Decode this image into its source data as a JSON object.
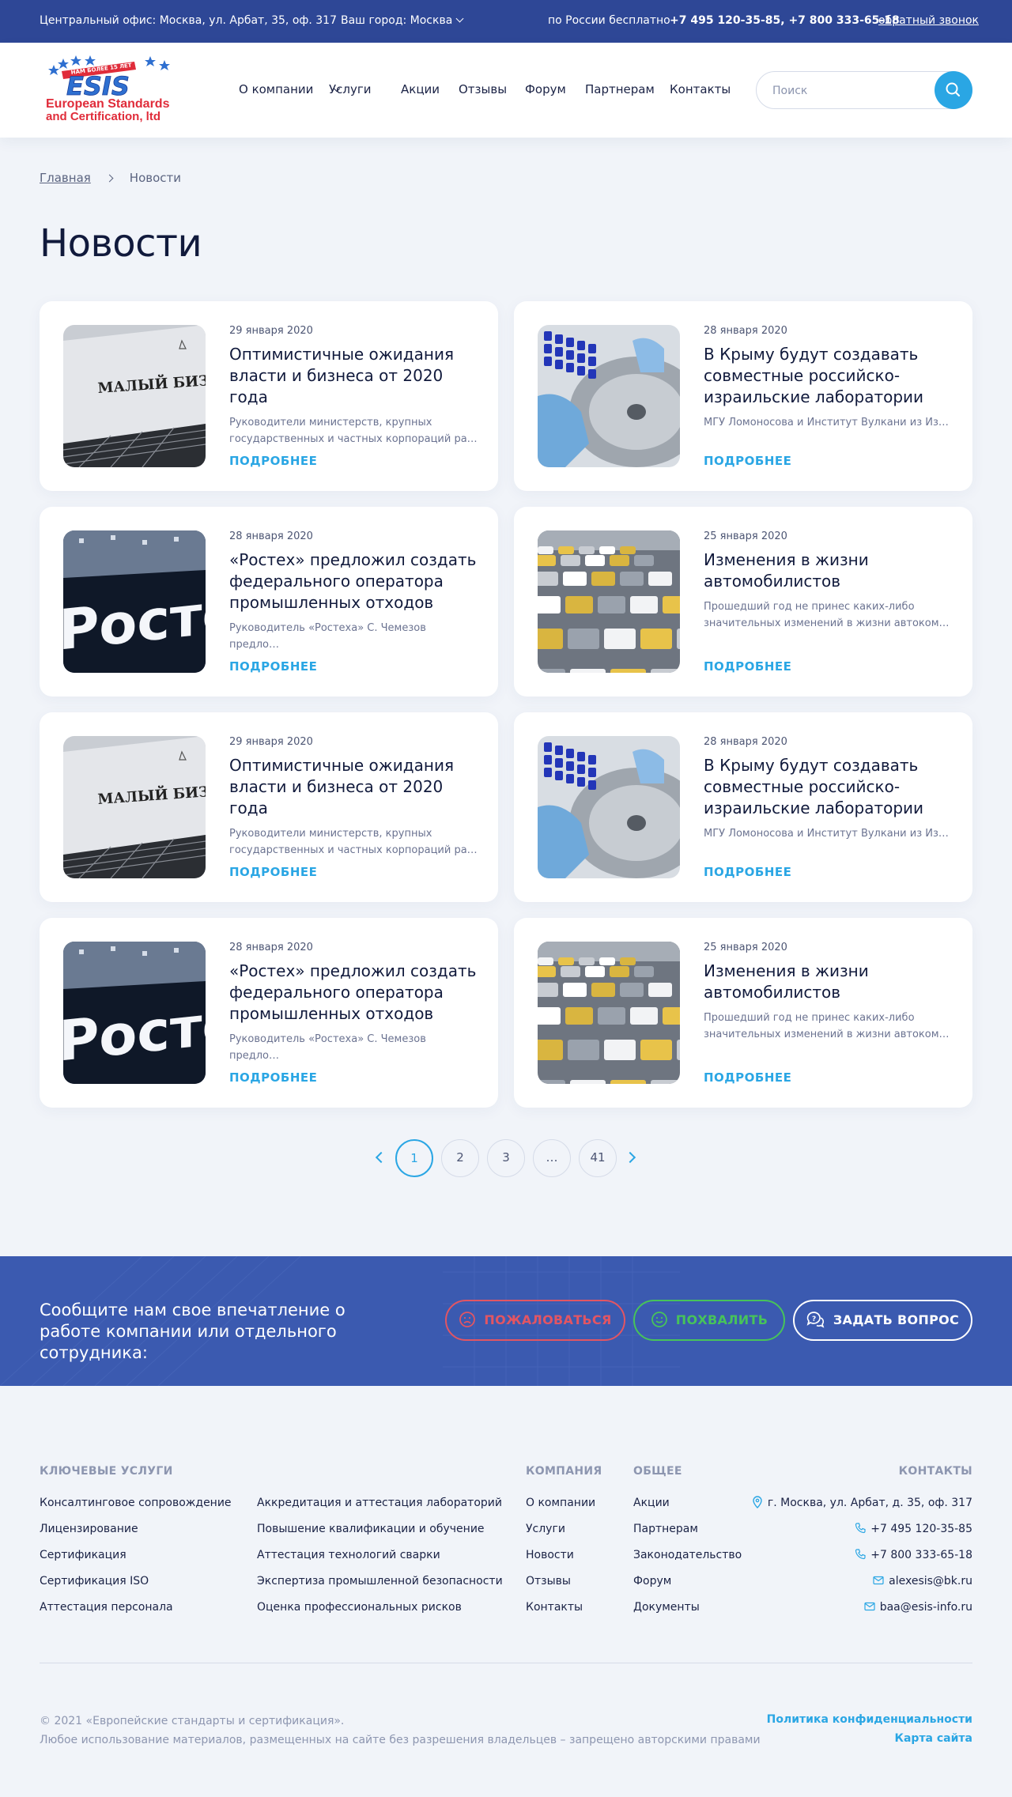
{
  "topbar": {
    "office": "Центральный офис: Москва, ул. Арбат, 35, оф. 317",
    "city": "Ваш город: Москва",
    "free_label": "по России бесплатно",
    "phones": "+7 495 120-35-85, +7 800 333-65-18",
    "callback": "обратный звонок"
  },
  "logo": {
    "badge": "НАМ БОЛЕЕ 15 ЛЕТ",
    "brand": "ESIS",
    "line1": "European Standards",
    "line2": "and Certification, ltd"
  },
  "nav": {
    "about": "О компании",
    "services": "Услуги",
    "promo": "Акции",
    "reviews": "Отзывы",
    "forum": "Форум",
    "partners": "Партнерам",
    "contacts": "Контакты"
  },
  "search": {
    "placeholder": "Поиск"
  },
  "breadcrumb": {
    "home": "Главная",
    "current": "Новости"
  },
  "page_title": "Новости",
  "news": [
    {
      "date": "29 января 2020",
      "title": "Оптимистичные ожидания власти и бизнеса от 2020 года",
      "desc": "Руководители министерств, крупных государственных и частных корпораций ра…",
      "more": "ПОДРОБНЕЕ",
      "image": "business-sign",
      "image_text": "МАЛЫЙ БИЗНЕС"
    },
    {
      "date": "28 января 2020",
      "title": "В Крыму будут создавать совместные российско-израильские лаборатории",
      "desc": "МГУ Ломоносова и Институт Вулкани из Из…",
      "more": "ПОДРОБНЕЕ",
      "image": "lab-centrifuge"
    },
    {
      "date": "28 января 2020",
      "title": "«Ростех» предложил создать федерального оператора промышленных отходов",
      "desc": "Руководитель «Ростеха» С. Чемезов предло…",
      "more": "ПОДРОБНЕЕ",
      "image": "rostec-sign",
      "image_text": "Ростех"
    },
    {
      "date": "25 января 2020",
      "title": "Изменения в жизни автомобилистов",
      "desc": "Прошедший год не принес каких-либо значительных изменений в жизни автоком…",
      "more": "ПОДРОБНЕЕ",
      "image": "traffic-jam"
    },
    {
      "date": "29 января 2020",
      "title": "Оптимистичные ожидания власти и бизнеса от 2020 года",
      "desc": "Руководители министерств, крупных государственных и частных корпораций ра…",
      "more": "ПОДРОБНЕЕ",
      "image": "business-sign",
      "image_text": "МАЛЫЙ БИЗНЕС"
    },
    {
      "date": "28 января 2020",
      "title": "В Крыму будут создавать совместные российско-израильские лаборатории",
      "desc": "МГУ Ломоносова и Институт Вулкани из Из…",
      "more": "ПОДРОБНЕЕ",
      "image": "lab-centrifuge"
    },
    {
      "date": "28 января 2020",
      "title": "«Ростех» предложил создать федерального оператора промышленных отходов",
      "desc": "Руководитель «Ростеха» С. Чемезов предло…",
      "more": "ПОДРОБНЕЕ",
      "image": "rostec-sign",
      "image_text": "Ростех"
    },
    {
      "date": "25 января 2020",
      "title": "Изменения в жизни автомобилистов",
      "desc": "Прошедший год не принес каких-либо значительных изменений в жизни автоком…",
      "more": "ПОДРОБНЕЕ",
      "image": "traffic-jam"
    }
  ],
  "pagination": {
    "pages": [
      "1",
      "2",
      "3",
      "…",
      "41"
    ],
    "current": "1"
  },
  "banner": {
    "text": "Сообщите нам свое впечатление о работе компании или отдельного сотрудника:",
    "complain": "ПОЖАЛОВАТЬСЯ",
    "praise": "ПОХВАЛИТЬ",
    "ask": "ЗАДАТЬ ВОПРОС"
  },
  "footer": {
    "services_heading": "КЛЮЧЕВЫЕ УСЛУГИ",
    "services_col1": [
      "Консалтинговое сопровождение",
      "Лицензирование",
      "Сертификация",
      "Сертификация ISO",
      "Аттестация персонала"
    ],
    "services_col2": [
      "Аккредитация и аттестация лабораторий",
      "Повышение квалификации и обучение",
      "Аттестация технологий сварки",
      "Экспертиза промышленной безопасности",
      "Оценка профессиональных рисков"
    ],
    "company_heading": "КОМПАНИЯ",
    "company": [
      "О компании",
      "Услуги",
      "Новости",
      "Отзывы",
      "Контакты"
    ],
    "general_heading": "ОБЩЕЕ",
    "general": [
      "Акции",
      "Партнерам",
      "Законодательство",
      "Форум",
      "Документы"
    ],
    "contacts_heading": "КОНТАКТЫ",
    "address": "г. Москва, ул. Арбат, д. 35, оф. 317",
    "phone1": "+7 495 120-35-85",
    "phone2": "+7 800 333-65-18",
    "email1": "alexesis@bk.ru",
    "email2": "baa@esis-info.ru",
    "copyright": "© 2021 «Европейские стандарты и сертификация».",
    "rights": "Любое использование материалов, размещенных на сайте без разрешения владельцев – запрещено авторскими правами",
    "privacy": "Политика конфиденциальности",
    "sitemap": "Карта сайта"
  },
  "colors": {
    "topbar": "#2e4796",
    "accent": "#2aa6e4",
    "banner": "#3b5ab0",
    "complain": "#e25563",
    "praise": "#47c35a"
  }
}
